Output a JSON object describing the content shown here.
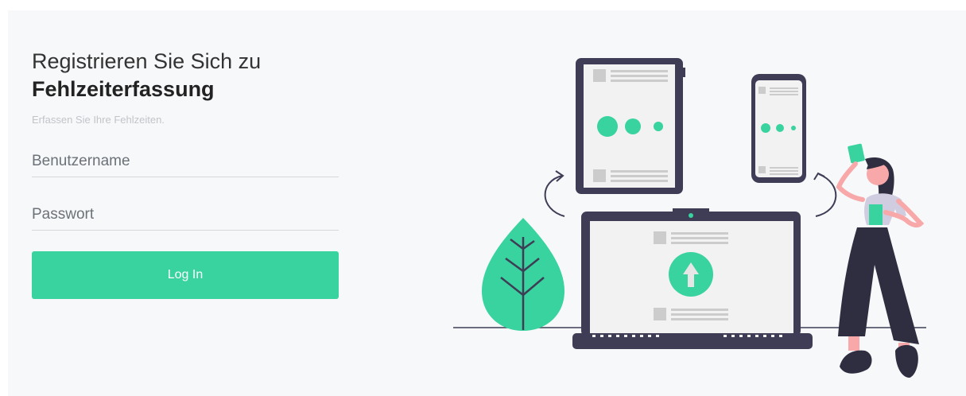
{
  "form": {
    "title_line1": "Registrieren Sie Sich zu",
    "title_line2": "Fehlzeiterfassung",
    "subtitle": "Erfassen Sie Ihre Fehlzeiten.",
    "username_placeholder": "Benutzername",
    "username_value": "",
    "password_placeholder": "Passwort",
    "password_value": "",
    "login_label": "Log In"
  },
  "colors": {
    "accent": "#38d39f",
    "dark": "#3f3d56",
    "background": "#f7f8fa"
  },
  "illustration": {
    "icons": [
      "tablet-device-icon",
      "phone-device-icon",
      "laptop-device-icon",
      "upload-arrow-icon",
      "leaf-plant-icon",
      "woman-figure-icon",
      "sync-arrow-icon"
    ]
  }
}
